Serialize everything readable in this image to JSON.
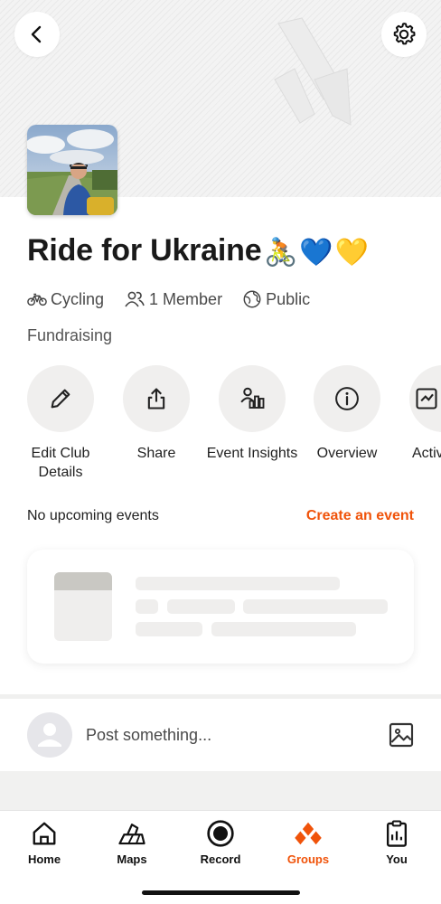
{
  "club": {
    "name": "Ride for Ukraine",
    "name_emoji": [
      "🚴",
      "💙",
      "💛"
    ],
    "sport": "Cycling",
    "members": "1 Member",
    "visibility": "Public",
    "tagline": "Fundraising"
  },
  "actions": [
    {
      "label": "Edit Club Details",
      "icon": "pencil-icon"
    },
    {
      "label": "Share",
      "icon": "share-icon"
    },
    {
      "label": "Event Insights",
      "icon": "event-insights-icon"
    },
    {
      "label": "Overview",
      "icon": "info-icon"
    },
    {
      "label": "Activ",
      "icon": "activities-icon"
    }
  ],
  "events": {
    "empty_text": "No upcoming events",
    "create_label": "Create an event"
  },
  "post": {
    "placeholder": "Post something..."
  },
  "tabs": [
    {
      "label": "Home",
      "icon": "home-icon",
      "active": false
    },
    {
      "label": "Maps",
      "icon": "maps-icon",
      "active": false
    },
    {
      "label": "Record",
      "icon": "record-icon",
      "active": false
    },
    {
      "label": "Groups",
      "icon": "groups-icon",
      "active": true
    },
    {
      "label": "You",
      "icon": "you-icon",
      "active": false
    }
  ],
  "colors": {
    "accent": "#f0530a",
    "action_circle": "#f0efee",
    "skeleton": "#efeeed"
  }
}
